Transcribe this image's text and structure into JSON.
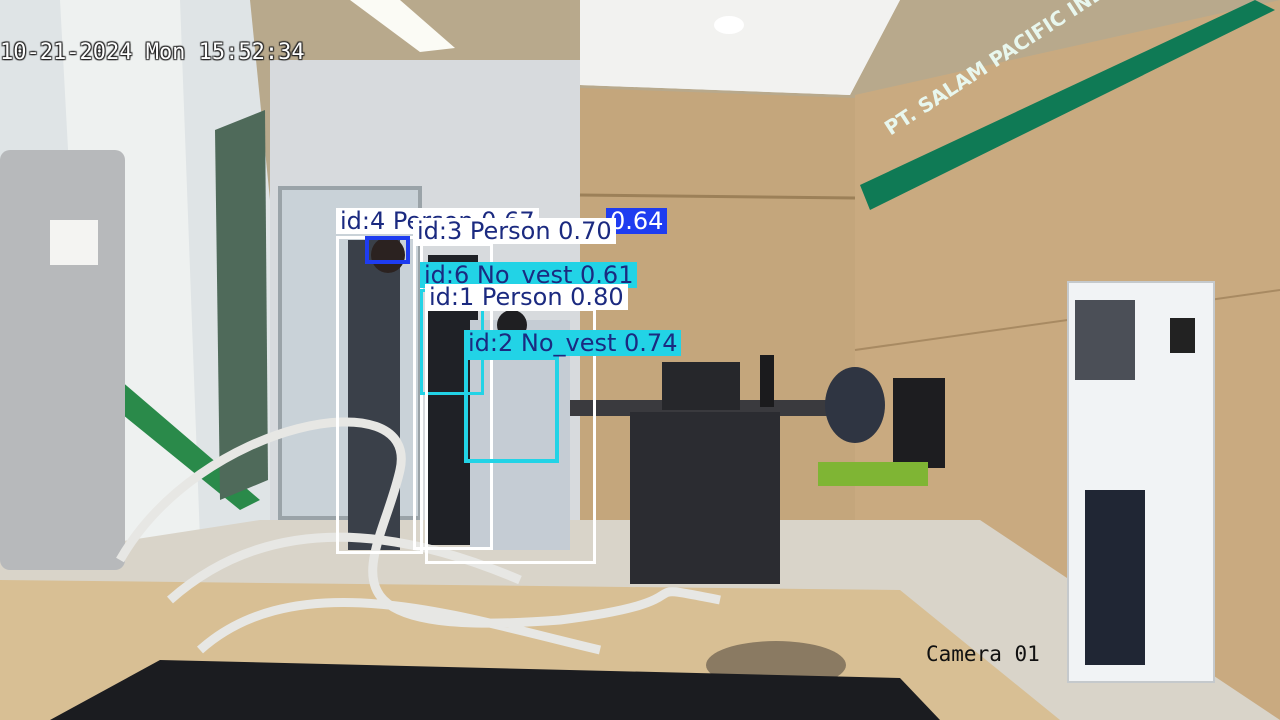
{
  "overlay": {
    "timestamp": "10-21-2024 Mon 15:52:34",
    "camera_label": "Camera 01"
  },
  "sign": {
    "text": "PT. SALAM PACIFIC INDONESIA LINES"
  },
  "detections": [
    {
      "id": "4",
      "label": "id:4 Person 0.67",
      "class": "Person",
      "color": "#ffffff"
    },
    {
      "id": "3",
      "label": "id:3 Person 0.70",
      "class": "Person",
      "color": "#ffffff"
    },
    {
      "id": "6",
      "label": "id:6 No_vest 0.61",
      "class": "No_vest",
      "color": "#22d3e6"
    },
    {
      "id": "1",
      "label": "id:1 Person 0.80",
      "class": "Person",
      "color": "#ffffff"
    },
    {
      "id": "2",
      "label": "id:2 No_vest 0.74",
      "class": "No_vest",
      "color": "#22d3e6"
    },
    {
      "id": "x",
      "label": "0.64",
      "class": "Vest",
      "color": "#1e3cf0"
    }
  ],
  "colors": {
    "person_box": "#ffffff",
    "no_vest_box": "#22d3e6",
    "vest_box": "#1e3cf0",
    "label_text": "#1b2a80",
    "sign_green": "#0f7a55"
  }
}
